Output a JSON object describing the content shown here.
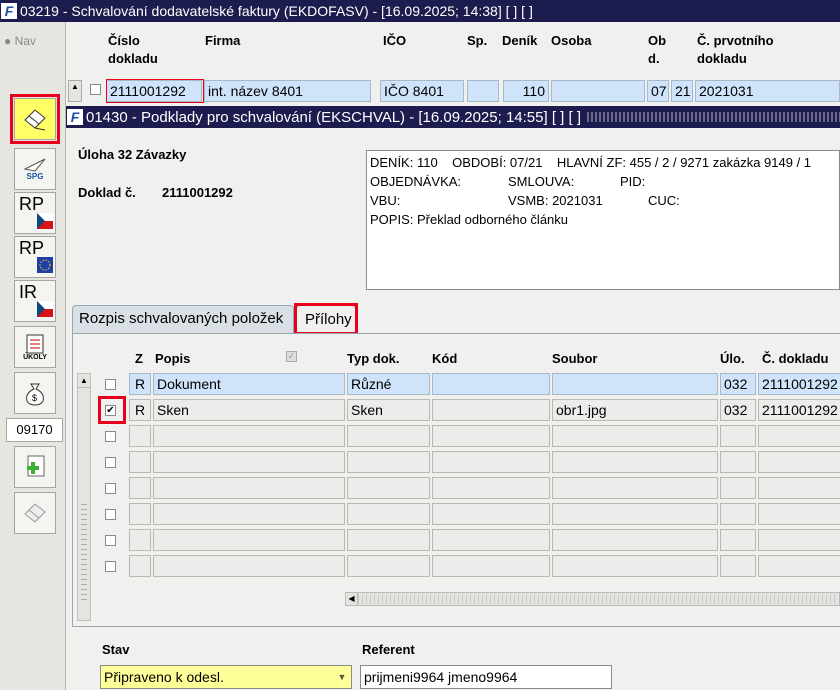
{
  "window1": {
    "title": "03219 - Schvalování dodavatelské faktury (EKDOFASV) - [16.09.2025; 14:38]  [ ]  [ ]",
    "icon": "app-logo-icon"
  },
  "nav_label": "Nav",
  "sidebar": {
    "counter": "09170",
    "buttons": [
      {
        "name": "approve-icon"
      },
      {
        "name": "spg-icon",
        "label": "SPG"
      },
      {
        "name": "rp-cz-icon",
        "label": "RP"
      },
      {
        "name": "rp-eu-icon",
        "label": "RP"
      },
      {
        "name": "ir-cz-icon",
        "label": "IR"
      },
      {
        "name": "ukoly-icon",
        "label": "ÚKOLY"
      },
      {
        "name": "money-bag-icon"
      },
      {
        "name": "add-document-icon"
      },
      {
        "name": "approve-disabled-icon"
      }
    ]
  },
  "table1": {
    "headers": {
      "cislo": "Číslo dokladu",
      "firma": "Firma",
      "ico": "IČO",
      "sp": "Sp.",
      "denik": "Deník",
      "osoba": "Osoba",
      "obd": "Ob d.",
      "prvotni": "Č. prvotního dokladu"
    },
    "row": {
      "cislo": "2111001292",
      "firma": "int. název 8401",
      "ico": "IČO 8401",
      "sp": "",
      "denik": "110",
      "osoba": "",
      "obd1": "07",
      "obd2": "21",
      "prvotni": "2021031"
    }
  },
  "window2": {
    "title": "01430 - Podklady pro schvalování (EKSCHVAL) - [16.09.2025; 14:55]  [ ]  [ ]"
  },
  "uloha": "Úloha 32 Závazky",
  "doklad_label": "Doklad č.",
  "doklad_value": "2111001292",
  "info": {
    "line1": "DENÍK: 110    OBDOBÍ: 07/21    HLAVNÍ ZF: 455 / 2 / 9271 zakázka 9149 / 1",
    "line2_a": "OBJEDNÁVKA:",
    "line2_b": "SMLOUVA:",
    "line2_c": "PID:",
    "line3_a": "VBU:",
    "line3_b": "VSMB: 2021031",
    "line3_c": "CUC:",
    "line4": "POPIS: Překlad odborného článku"
  },
  "tabs": {
    "rozpis": "Rozpis schvalovaných položek",
    "prilohy": "Přílohy"
  },
  "grid": {
    "headers": {
      "z": "Z",
      "popis": "Popis",
      "typ": "Typ dok.",
      "kod": "Kód",
      "soubor": "Soubor",
      "ulo": "Úlo.",
      "cdoklad": "Č. dokladu"
    },
    "rows": [
      {
        "checked": false,
        "z": "R",
        "popis": "Dokument",
        "typ": "Různé",
        "kod": "",
        "soubor": "",
        "ulo": "032",
        "cd": "2111001292"
      },
      {
        "checked": true,
        "z": "R",
        "popis": "Sken",
        "typ": "Sken",
        "kod": "",
        "soubor": "obr1.jpg",
        "ulo": "032",
        "cd": "2111001292"
      },
      {
        "checked": false,
        "z": "",
        "popis": "",
        "typ": "",
        "kod": "",
        "soubor": "",
        "ulo": "",
        "cd": ""
      },
      {
        "checked": false,
        "z": "",
        "popis": "",
        "typ": "",
        "kod": "",
        "soubor": "",
        "ulo": "",
        "cd": ""
      },
      {
        "checked": false,
        "z": "",
        "popis": "",
        "typ": "",
        "kod": "",
        "soubor": "",
        "ulo": "",
        "cd": ""
      },
      {
        "checked": false,
        "z": "",
        "popis": "",
        "typ": "",
        "kod": "",
        "soubor": "",
        "ulo": "",
        "cd": ""
      },
      {
        "checked": false,
        "z": "",
        "popis": "",
        "typ": "",
        "kod": "",
        "soubor": "",
        "ulo": "",
        "cd": ""
      },
      {
        "checked": false,
        "z": "",
        "popis": "",
        "typ": "",
        "kod": "",
        "soubor": "",
        "ulo": "",
        "cd": ""
      }
    ]
  },
  "stav": {
    "label": "Stav",
    "value": "Připraveno k odesl."
  },
  "referent": {
    "label": "Referent",
    "value": "prijmeni9964 jmeno9964"
  },
  "colors": {
    "titlebar": "#1c1c4e",
    "selection": "#cfe4fa",
    "highlight_red": "#e8001c",
    "stav_bg": "#ffff99"
  }
}
